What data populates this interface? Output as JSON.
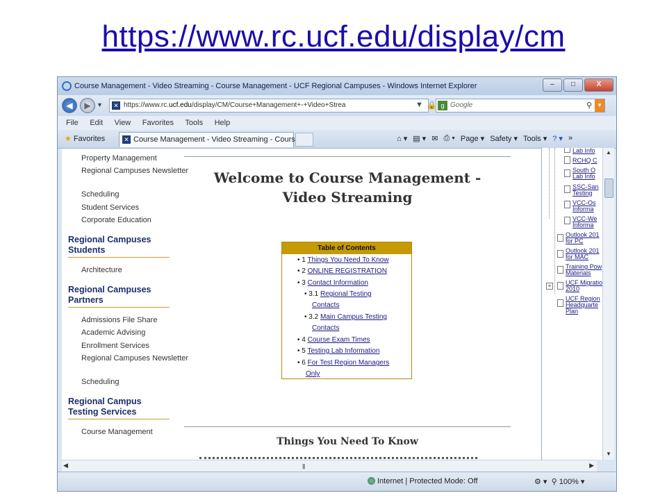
{
  "slide": {
    "title": "https://www.rc.ucf.edu/display/cm"
  },
  "window": {
    "title": "Course Management - Video Streaming - Course Management - UCF Regional Campuses - Windows Internet Explorer",
    "min": "–",
    "max": "□",
    "close": "X"
  },
  "address": {
    "url_pre": "https://www.rc.",
    "url_domain": "ucf.edu",
    "url_post": "/display/CM/Course+Management+-+Video+Strea",
    "search_placeholder": "Google"
  },
  "menu": [
    "File",
    "Edit",
    "View",
    "Favorites",
    "Tools",
    "Help"
  ],
  "tabs": {
    "favorites_label": "Favorites",
    "active_tab": "Course Management - Video Streaming - Course ..."
  },
  "commandbar": {
    "page": "Page ▾",
    "safety": "Safety ▾",
    "tools": "Tools ▾",
    "help": "? ▾"
  },
  "leftnav": {
    "group1": [
      "Property Management",
      "Regional Campuses Newsletter",
      "Scheduling",
      "Student Services",
      "Corporate Education"
    ],
    "head_students": "Regional Campuses Students",
    "group2": [
      "Architecture"
    ],
    "head_partners": "Regional Campuses Partners",
    "group3": [
      "Admissions File Share",
      "Academic Advising",
      "Enrollment Services",
      "Regional Campuses Newsletter",
      "Scheduling"
    ],
    "head_testing": "Regional Campus Testing Services",
    "group4": [
      "Course Management"
    ]
  },
  "main": {
    "title_line1": "Welcome to Course Management -",
    "title_line2": "Video Streaming",
    "toc_title": "Table of Contents",
    "toc": [
      {
        "bullet": "•",
        "num": "1",
        "text": "Things You Need To Know"
      },
      {
        "bullet": "•",
        "num": "2",
        "text": "ONLINE REGISTRATION"
      },
      {
        "bullet": "•",
        "num": "3",
        "text": "Contact Information"
      },
      {
        "bullet": "•",
        "num": "3.1",
        "text": "Regional Testing",
        "cont": "Contacts"
      },
      {
        "bullet": "•",
        "num": "3.2",
        "text": "Main Campus Testing",
        "cont": "Contacts"
      },
      {
        "bullet": "•",
        "num": "4",
        "text": "Course Exam Times"
      },
      {
        "bullet": "•",
        "num": "5",
        "text": "Testing Lab Information"
      },
      {
        "bullet": "•",
        "num": "6",
        "text": "For Test Region Managers",
        "cont": "Only"
      }
    ],
    "section_title": "Things You Need To Know"
  },
  "tree": [
    "Lab Info",
    "RCHQ C",
    "South O",
    "Lab Info",
    "SSC-San",
    "Testing",
    "VCC-Os",
    "Informa",
    "VCC-We",
    "Informa",
    "Outlook 201",
    "for PC",
    "Outlook 201",
    "for MAC",
    "Training Pow",
    "Materials",
    "UCF Migratio",
    "2010",
    "UCF Region",
    "Headquarte",
    "Plan"
  ],
  "statusbar": {
    "zone": "Internet | Protected Mode: Off",
    "zoom": "100%"
  },
  "colors": {
    "accent_gold": "#c49a06",
    "link": "#1a1a80",
    "heading_navy": "#1c2e6b"
  }
}
